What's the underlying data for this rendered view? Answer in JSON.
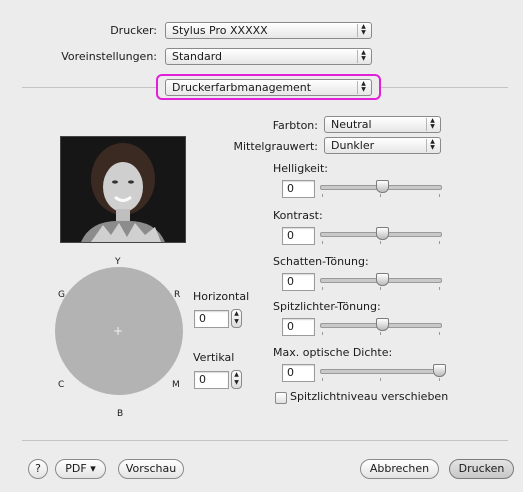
{
  "top": {
    "printer_label": "Drucker:",
    "printer_value": "Stylus Pro XXXXX",
    "presets_label": "Voreinstellungen:",
    "presets_value": "Standard",
    "panel_value": "Druckerfarbmanagement",
    "highlight_color": "#e21fd9"
  },
  "color": {
    "tone_label": "Farbton:",
    "tone_value": "Neutral",
    "gray_label": "Mittelgrauwert:",
    "gray_value": "Dunkler"
  },
  "adjustments": [
    {
      "label": "Helligkeit:",
      "value": "0",
      "level": 0.5
    },
    {
      "label": "Kontrast:",
      "value": "0",
      "level": 0.5
    },
    {
      "label": "Schatten-Tönung:",
      "value": "0",
      "level": 0.5
    },
    {
      "label": "Spitzlichter-Tönung:",
      "value": "0",
      "level": 0.5
    },
    {
      "label": "Max. optische Dichte:",
      "value": "0",
      "level": 0.97
    }
  ],
  "highlight_checkbox": {
    "label": "Spitzlichtniveau verschieben",
    "checked": false
  },
  "color_circle": {
    "labels": {
      "y": "Y",
      "r": "R",
      "m": "M",
      "b": "B",
      "c": "C",
      "g": "G"
    },
    "center": "+",
    "fill_color": "#b3b3b3",
    "horizontal_label": "Horizontal",
    "horizontal_value": "0",
    "vertical_label": "Vertikal",
    "vertical_value": "0"
  },
  "bottom": {
    "help": "?",
    "pdf": "PDF ▾",
    "preview": "Vorschau",
    "cancel": "Abbrechen",
    "print": "Drucken"
  }
}
